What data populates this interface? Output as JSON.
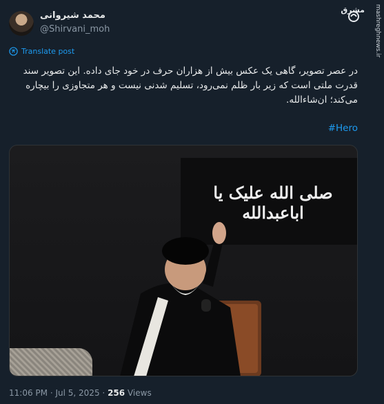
{
  "author": {
    "display_name": "محمد شیروانی",
    "handle": "@Shirvani_moh"
  },
  "watermark": {
    "brand": "مشرق",
    "site": "mashreghnews.ir"
  },
  "translate_label": "Translate post",
  "tweet_text": "در عصر تصویر، گاهی یک عکس بیش از هزاران حرف در خود جای داده. این تصویر سند قدرت ملتی است که زیر بار ظلم نمی‌رود، تسلیم شدنی نیست و هر متجاوزی را بیچاره می‌کند؛ ان‌شاءالله.",
  "hashtag": "#Hero",
  "photo": {
    "banner_text": "صلی الله علیک یا اباعبدالله"
  },
  "meta": {
    "time": "11:06 PM",
    "separator": "·",
    "date": "Jul 5, 2025",
    "views_count": "256",
    "views_label": "Views"
  },
  "colors": {
    "background": "#16202b",
    "link": "#1d9bf0",
    "muted": "#8b98a5"
  }
}
